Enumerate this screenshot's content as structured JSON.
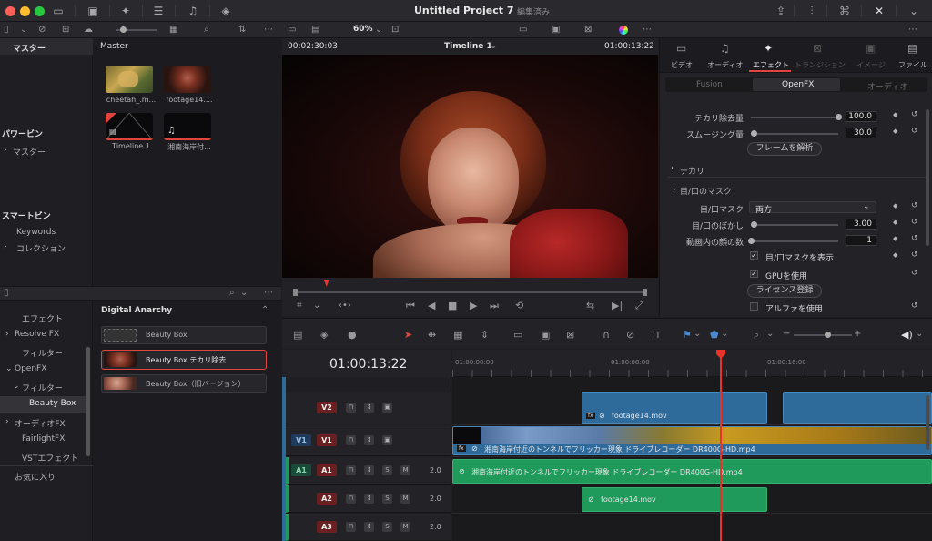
{
  "window": {
    "title": "Untitled Project 7",
    "subtitle": "編集済み",
    "zoom": "60%"
  },
  "colors": {
    "close": "#fe5f57",
    "minimize": "#febc2e",
    "maximize": "#28c840",
    "accent_red": "#e0443c",
    "video_clip": "#2e6a9a",
    "audio_clip": "#1f9a5a",
    "playhead": "#e8332b"
  },
  "media_pool": {
    "sidebar_header": "マスター",
    "main_header": "Master",
    "sections": [
      {
        "label": "パワービン"
      },
      {
        "label": "マスター"
      },
      {
        "label": "スマートビン"
      },
      {
        "label": "Keywords"
      },
      {
        "label": "コレクション"
      }
    ],
    "clips": [
      {
        "name": "cheetah_.m..."
      },
      {
        "name": "footage14...."
      },
      {
        "name": "Timeline 1"
      },
      {
        "name": "湘南海岸付..."
      }
    ]
  },
  "effects_library": {
    "tree": [
      {
        "label": "エフェクト"
      },
      {
        "label": "Resolve FX"
      },
      {
        "label": "フィルター"
      },
      {
        "label": "OpenFX"
      },
      {
        "label": "フィルター"
      },
      {
        "label": "Beauty Box"
      },
      {
        "label": "オーディオFX"
      },
      {
        "label": "FairlightFX"
      },
      {
        "label": "VSTエフェクト"
      },
      {
        "label": "お気に入り"
      }
    ],
    "group_title": "Digital Anarchy",
    "items": [
      {
        "label": "Beauty Box"
      },
      {
        "label": "Beauty Box テカリ除去"
      },
      {
        "label": "Beauty Box（旧バージョン）"
      }
    ]
  },
  "viewer": {
    "source_timecode": "00:02:30:03",
    "timeline_name": "Timeline 1",
    "record_timecode": "01:00:13:22",
    "playhead_fraction": 0.09
  },
  "inspector": {
    "tabs": [
      {
        "label": "ビデオ"
      },
      {
        "label": "オーディオ"
      },
      {
        "label": "エフェクト"
      },
      {
        "label": "トランジション"
      },
      {
        "label": "イメージ"
      },
      {
        "label": "ファイル"
      }
    ],
    "subtabs": [
      {
        "label": "Fusion"
      },
      {
        "label": "OpenFX"
      },
      {
        "label": "オーディオ"
      }
    ],
    "params": {
      "shine_amount": {
        "label": "テカリ除去量",
        "value": "100.0",
        "fraction": 1.0
      },
      "smoothing": {
        "label": "スムージング量",
        "value": "30.0",
        "fraction": 0.03
      },
      "analyze_button": "フレームを解析",
      "shine_section": "テカリ",
      "eye_mouth_section": "目/口のマスク",
      "eye_mouth_mask": {
        "label": "目/口マスク",
        "value": "両方"
      },
      "eye_mouth_blur": {
        "label": "目/口のぼかし",
        "value": "3.00",
        "fraction": 0.03
      },
      "faces_count": {
        "label": "動画内の顔の数",
        "value": "1",
        "fraction": 0.0
      },
      "show_mask": "目/口マスクを表示",
      "use_gpu": "GPUを使用",
      "license_button": "ライセンス登録",
      "use_alpha": "アルファを使用"
    }
  },
  "timeline": {
    "timecode": "01:00:13:22",
    "ruler": [
      {
        "label": "01:00:00:00"
      },
      {
        "label": "01:00:08:00"
      },
      {
        "label": "01:00:16:00"
      }
    ],
    "tracks": {
      "v2": {
        "name": "V2"
      },
      "v1": {
        "source": "V1",
        "name": "V1"
      },
      "a1": {
        "source": "A1",
        "name": "A1",
        "level": "2.0"
      },
      "a2": {
        "name": "A2",
        "level": "2.0"
      },
      "a3": {
        "name": "A3",
        "level": "2.0"
      }
    },
    "clips": {
      "v2_clip_a": "footage14.mov",
      "v1_clip": "湘南海岸付近のトンネルでフリッカー現象 ドライブレコーダー DR400G-HD.mp4",
      "a1_clip": "湘南海岸付近のトンネルでフリッカー現象 ドライブレコーダー DR400G-HD.mp4",
      "a2_clip": "footage14.mov"
    },
    "fx_badge": "fx",
    "solo_label": "S",
    "mute_label": "M"
  }
}
